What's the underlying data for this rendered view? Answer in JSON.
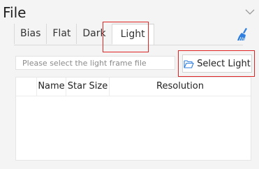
{
  "panel": {
    "title": "File",
    "collapse_icon": "chevron-down-icon"
  },
  "tabs": [
    {
      "label": "Bias",
      "active": false
    },
    {
      "label": "Flat",
      "active": false
    },
    {
      "label": "Dark",
      "active": false
    },
    {
      "label": "Light",
      "active": true
    }
  ],
  "toolbar": {
    "clear_icon": "broom-icon"
  },
  "file_picker": {
    "placeholder": "Please select the light frame file",
    "button_label": "Select Light",
    "button_icon": "folder-open-icon"
  },
  "table": {
    "columns": [
      "",
      "Name",
      "Star Size",
      "Resolution"
    ],
    "rows": []
  },
  "colors": {
    "highlight": "#e02424",
    "accent": "#2f7fe0"
  }
}
